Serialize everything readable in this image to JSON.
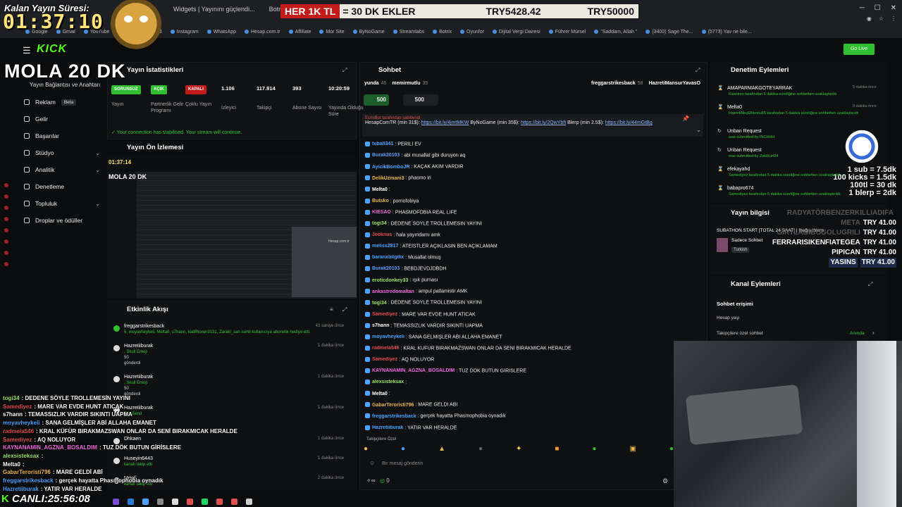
{
  "overlay": {
    "timer_title": "Kalan Yayın Süresi:",
    "timer": "01:37:10",
    "ticker_red": "HER 1K TL",
    "ticker_text": " = 30 DK EKLER",
    "ticker_amount1": "TRY5428.42",
    "ticker_amount2": "TRY50000",
    "mola": "MOLA 20 DK",
    "canli_label": "CANLI:25:56:08",
    "subs_lines": [
      "1 sub = 7.5dk",
      "100 kicks = 1.5dk",
      "100tl = 30 dk",
      "1 blerp = 2dk"
    ]
  },
  "browser": {
    "tabs": [
      "Widgets | Yayınını güçlendi...",
      "Botrix | Cekilişler",
      "HER 1K TL = 30 DK EKLER"
    ],
    "bookmarks": [
      "Google",
      "Gmail",
      "YouTube",
      "Kick | Dashboard",
      "Instagram",
      "WhatsApp",
      "Hesap.com.tr",
      "Affiliate",
      "Mor Site",
      "ByNoGame",
      "Streamlabs",
      "Botrix",
      "Oyunfor",
      "Dijital Vergi Dairesi",
      "Führer Mürsel",
      "\"Saddam, Allah \"",
      "(3400) Sage The...",
      "(5773) Yav ne bile..."
    ]
  },
  "header": {
    "logo": "KICK",
    "golive": "Go Live"
  },
  "sidebar": {
    "subtitle": "Yayın Bağlantısı ve Anahtarı",
    "items": [
      {
        "label": "Reklam",
        "badge": "Beta"
      },
      {
        "label": "Gelir"
      },
      {
        "label": "Başarılar"
      },
      {
        "label": "Stüdyo"
      },
      {
        "label": "Analitik"
      },
      {
        "label": "Denetleme"
      },
      {
        "label": "Topluluk"
      },
      {
        "label": "Droplar ve ödüller"
      }
    ]
  },
  "stats": {
    "title": "Yayın İstatistikleri",
    "items": [
      {
        "value": "SORUNSUZ",
        "label": "Yayın",
        "color": "#2fbf2f"
      },
      {
        "value": "AÇIK",
        "label": "Partnerlik Gelir Programı",
        "color": "#2fbf2f"
      },
      {
        "value": "KAPALI",
        "label": "Çoklu Yayın",
        "color": "#c31a1a"
      },
      {
        "value": "1.106",
        "label": "İzleyici"
      },
      {
        "value": "117.914",
        "label": "Takipçi"
      },
      {
        "value": "393",
        "label": "Abone Sayısı"
      },
      {
        "value": "10:20:59",
        "label": "Yayında Olduğu Süre"
      }
    ],
    "status": "Your connection has stabilised. Your stream will continue."
  },
  "preview": {
    "title": "Yayın Ön İzlemesi",
    "mini_timer": "01:37:14",
    "mini_mola": "MOLA 20 DK",
    "mini_site": "Hesap.com.tr"
  },
  "activity": {
    "title": "Etkinlik Akışı",
    "items": [
      {
        "user": "freggarstrikesback",
        "sub": "5, moyavheykeli, Melta0, s7hann, kadRtorun3131, Zaraki_san isimli kullanıcıya abonelik hediye etti.",
        "time": "43 saniye önce"
      },
      {
        "user": "Hazretiiburak",
        "sub": ", Skull Emoji",
        "extra": "50",
        "extra2": "gönderdi",
        "time": "1 dakika önce"
      },
      {
        "user": "Hazretiiburak",
        "sub": ", Skull Emoji",
        "extra": "50",
        "extra2": "gönderdi",
        "time": "1 dakika önce"
      },
      {
        "user": "Hazretiiburak",
        "sub": "Full Send",
        "extra": "",
        "time": "1 dakika önce"
      },
      {
        "user": "Dhkaen",
        "sub": "",
        "time": "1 dakika önce"
      },
      {
        "user": "Huseyin6443",
        "sub": "kanalı takip etti",
        "time": "1 dakika önce"
      },
      {
        "user": "Mrtoli",
        "sub": "kanalı takip etti",
        "time": "2 dakika önce"
      }
    ]
  },
  "chat": {
    "title": "Sohbet",
    "top": [
      {
        "name": "yunda",
        "n": "45"
      },
      {
        "name": "memirmutlu",
        "n": "35"
      },
      {
        "name": "freggarstrikesback",
        "n": "58"
      },
      {
        "name": "HazretiMansurYavasO",
        "n": ""
      }
    ],
    "gift1": "500",
    "gift2": "500",
    "pinned_by": "EcrinBot tarafından sabitlendi",
    "pinned_pre": "HesapComTR (min 31$): ",
    "pinned_link1": "https://bit.ly/4jmtMKW",
    "pinned_mid": " ByNoGame (min 35$): ",
    "pinned_link2": "https://bit.ly/2QwYbft",
    "pinned_mid2": " Blerp (min 2.5$): ",
    "pinned_link3": "https://bit.ly/44mGtBg",
    "messages": [
      {
        "u": "tuball341",
        "c": "#4aa3ff",
        "t": ": PERİLİ EV"
      },
      {
        "u": "Burak20103",
        "c": "#5aa0ff",
        "t": ": abi musallat gibi duruyon aq"
      },
      {
        "u": "AyicikBomboJR",
        "c": "#4aa3ff",
        "t": ": KAÇAK AKIM VARDIR"
      },
      {
        "u": "DelikUzmani3",
        "c": "#e8b84a",
        "t": ": phasmo iri"
      },
      {
        "u": "Melta0",
        "c": "#ffffff",
        "t": ":"
      },
      {
        "u": "Butsko",
        "c": "#e8b84a",
        "t": ": pornofobiya"
      },
      {
        "u": "KIESAO",
        "c": "#f06ae0",
        "t": ": PHASMOFOBIA REAL LIFE"
      },
      {
        "u": "togi34",
        "c": "#9be36a",
        "t": ": DEDENE SÖYLE TROLLEMESİN YAYINI"
      },
      {
        "u": "Jeoknus",
        "c": "#e04e4e",
        "t": ": hala yayındamı amk"
      },
      {
        "u": "meliss2817",
        "c": "#4aa3ff",
        "t": ": ATEİSTLER AÇIKLASIN BEN AÇIKLAMAM"
      },
      {
        "u": "baranxbilgilix",
        "c": "#4aa3ff",
        "t": ": Musallat olmuş"
      },
      {
        "u": "Burak20103",
        "c": "#5aa0ff",
        "t": ": BEBDJEVDJDBDH"
      },
      {
        "u": "eroticdonkey33",
        "c": "#9be36a",
        "t": ": ışık purnası"
      },
      {
        "u": "ankastredomaltan",
        "c": "#f06ae0",
        "t": ": ampul patlamistir AMK"
      },
      {
        "u": "togi34",
        "c": "#9be36a",
        "t": ": DEDENE SÖYLE TROLLEMESİN YAYINI"
      },
      {
        "u": "Samediyez",
        "c": "#e04e4e",
        "t": ": MARE VAR EVDE HUNT ATICAK"
      },
      {
        "u": "s7hann",
        "c": "#ffffff",
        "t": ": TEMASSIZLIK VARDIR SIKINTI UAPMA"
      },
      {
        "u": "moyavheykeli",
        "c": "#4aa3ff",
        "t": ": SANA GELMİŞLER ABİ ALLAHA EMANET"
      },
      {
        "u": "radmela546",
        "c": "#e04e4e",
        "t": ": KRAL KÜFÜR BIRAKMAZSWAN ONLAR DA SENİ BIRAKMICAK HERALDE"
      },
      {
        "u": "Samediyez",
        "c": "#e04e4e",
        "t": ": AQ NOLUYOR"
      },
      {
        "u": "KAYNANAMIN_AGZNA_BOSALDIM",
        "c": "#f06ae0",
        "t": ": TUZ DÖK BUTUN GİRİSLERE"
      },
      {
        "u": "alexsisteksax",
        "c": "#9be36a",
        "t": ":"
      },
      {
        "u": "Melta0",
        "c": "#ffffff",
        "t": ":"
      },
      {
        "u": "GabarTeroristi796",
        "c": "#e8b84a",
        "t": ": MARE GELDİ ABİ"
      },
      {
        "u": "freggarstrikesback",
        "c": "#4aa3ff",
        "t": ": gerçek hayatta Phasmophobia oynadık"
      },
      {
        "u": "Hazretiiburak",
        "c": "#4aa3ff",
        "t": ": YATIR VAR HERALDE"
      }
    ],
    "followers_only": "Takipçilere Özel",
    "placeholder": "Bir mesaj gönderin",
    "points": "0"
  },
  "moderation": {
    "title": "Denetim Eylemleri",
    "items": [
      {
        "action": "AMAPARMAKGOTEYARRAK",
        "sub": "Kaanires tarafından 5 dakika süreliğine sohbetten uzaklaştırıldı",
        "time": "5 dakika önce"
      },
      {
        "action": "Melta0",
        "sub": "HazretiNeçEfilsonu85 tarafından 5 dakika süreliğine sohbetten uzaklaştırıldı",
        "time": "9 dakika önce"
      },
      {
        "action": "Unban Request",
        "sub": "was submitted by INCHHH",
        "time": ""
      },
      {
        "action": "Unban Request",
        "sub": "was submitted by ZekiKurt54",
        "time": ""
      },
      {
        "action": "efekayahd",
        "sub": "Samediyez tarafından 5 dakika süreliğine sohbetten uzaklaştırıldı",
        "time": ""
      },
      {
        "action": "babapro674",
        "sub": "Samediyez tarafından 5 dakika süreliğine sohbetten uzaklaştırıldı",
        "time": ""
      }
    ]
  },
  "stream_info": {
    "title": "Yayın bilgisi",
    "text": "SUBATHON START [TOTAL 24 SAAT] | !bağış !blerp",
    "category": "Sadece Sohbet",
    "language": "Turkish"
  },
  "donors": [
    {
      "name": "RADYATÖRBENZERKILLIADIFA",
      "amount": ""
    },
    {
      "name": "META",
      "amount": "TRY 41.00"
    },
    {
      "name": "GIRTLAGIBOGOLUGRILI",
      "amount": "TRY 41.00"
    },
    {
      "name": "FERRARISIKENFIATEGEA",
      "amount": "TRY 41.00"
    },
    {
      "name": "PIPICAN",
      "amount": "TRY 41.00"
    },
    {
      "name": "YASINS",
      "amount": "TRY 41.00"
    }
  ],
  "channel": {
    "title": "Kanal Eylemleri",
    "chat_access": "Sohbet erişimi",
    "account_age": "Hesap yaşı",
    "followers_only": "Takipçilere özel sohbet",
    "followers_value": "Anında"
  },
  "overlay_chat": [
    {
      "u": "togi34",
      "c": "#9be36a",
      "t": ": DEDENE SÖYLE TROLLEMESİN YAYINI"
    },
    {
      "u": "Samediyez",
      "c": "#e04e4e",
      "t": ": MARE VAR EVDE HUNT ATICAK"
    },
    {
      "u": "s7hann",
      "c": "#ffffff",
      "t": ": TEMASSIZLIK VARDIR SIKINTI UAPMA"
    },
    {
      "u": "moyavheykeli",
      "c": "#4aa3ff",
      "t": ": SANA GELMİŞLER ABİ ALLAHA EMANET"
    },
    {
      "u": "radmela546",
      "c": "#e04e4e",
      "t": ": KRAL KÜFÜR BIRAKMAZSWAN ONLAR DA SENİ BIRAKMICAK HERALDE"
    },
    {
      "u": "Samediyez",
      "c": "#e04e4e",
      "t": ": AQ NOLUYOR"
    },
    {
      "u": "KAYNANAMIN_AGZNA_BOSALDIM",
      "c": "#f06ae0",
      "t": ": TUZ DÖK BUTUN GİRİSLERE"
    },
    {
      "u": "alexsisteksax",
      "c": "#9be36a",
      "t": ":"
    },
    {
      "u": "Melta0",
      "c": "#ffffff",
      "t": ":"
    },
    {
      "u": "GabarTeroristi796",
      "c": "#e8b84a",
      "t": ": MARE GELDİ ABİ"
    },
    {
      "u": "freggarstrikesback",
      "c": "#4aa3ff",
      "t": ": gerçek hayatta Phasmophobia oynadık"
    },
    {
      "u": "Hazretiiburak",
      "c": "#4aa3ff",
      "t": ": YATIR VAR HERALDE"
    }
  ]
}
